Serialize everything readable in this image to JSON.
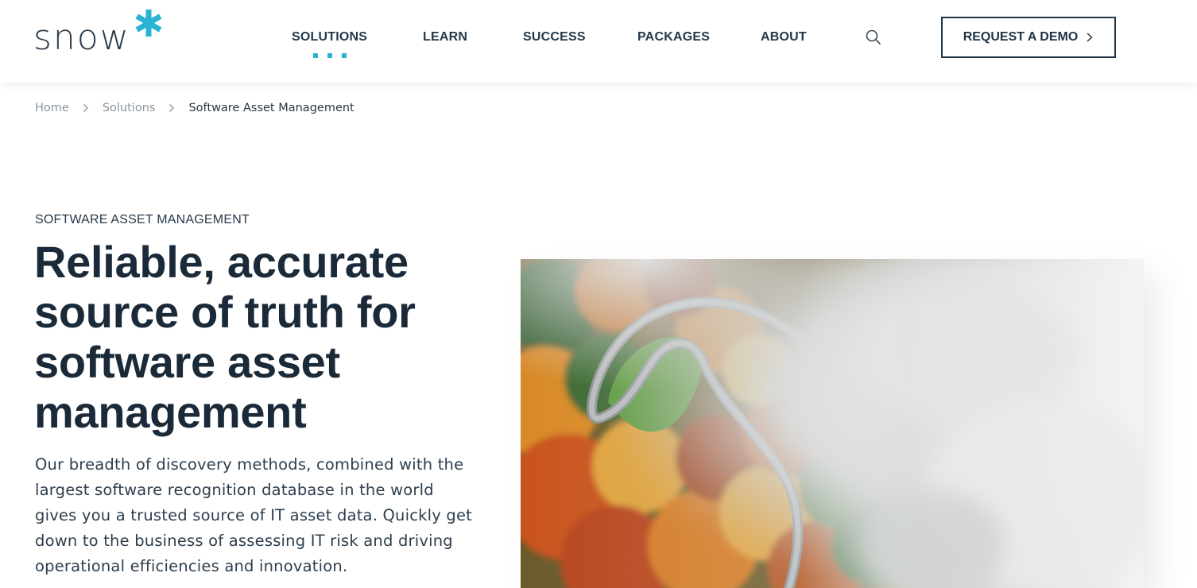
{
  "header": {
    "logo": {
      "wordmark": "snow",
      "accent_color": "#2bb3d4"
    },
    "nav": [
      {
        "label": "SOLUTIONS",
        "active": true
      },
      {
        "label": "LEARN",
        "active": false
      },
      {
        "label": "SUCCESS",
        "active": false
      },
      {
        "label": "PACKAGES",
        "active": false
      },
      {
        "label": "ABOUT",
        "active": false
      }
    ],
    "search_icon": "search-icon",
    "cta_label": "REQUEST A DEMO",
    "cta_icon": "chevron-right-icon"
  },
  "breadcrumb": {
    "items": [
      "Home",
      "Solutions"
    ],
    "current": "Software Asset Management"
  },
  "hero": {
    "eyebrow": "SOFTWARE ASSET MANAGEMENT",
    "title": "Reliable, accurate source of truth for software asset management",
    "body": "Our breadth of discovery methods, combined with the largest software recognition database in the world gives you a trusted source of IT asset data. Quickly get down to the business of assessing IT risk and driving operational efficiencies and innovation.",
    "image": "aerial-autumn-forest-road-with-fog"
  },
  "colors": {
    "text_dark": "#1a2a38",
    "accent": "#2bb3d4",
    "muted": "#8a939c"
  }
}
